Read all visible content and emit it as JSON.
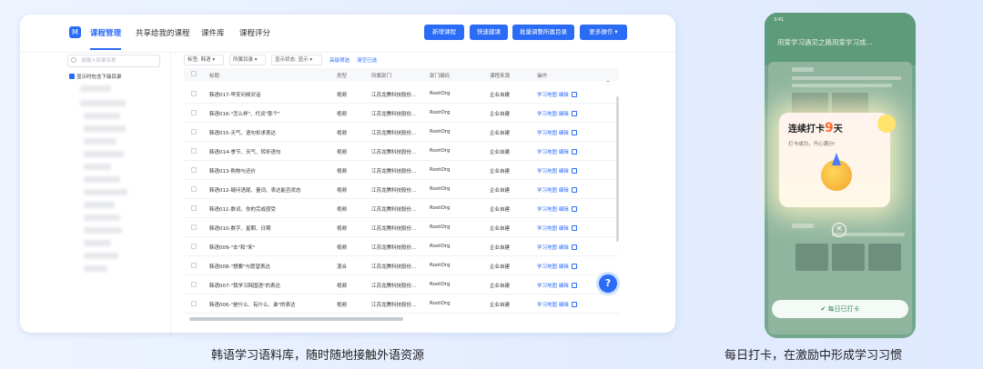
{
  "nav": {
    "logo_text": "M",
    "tabs": [
      {
        "label": "课程管理"
      },
      {
        "label": "共享给我的课程"
      },
      {
        "label": "课件库"
      },
      {
        "label": "课程评分"
      }
    ],
    "buttons": {
      "new_course": "新增课程",
      "quick_create": "快速建课",
      "batch_adjust": "批量调整所属目录",
      "more": "更多操作"
    }
  },
  "sidebar": {
    "search_placeholder": "请输入目录名称",
    "include_sub": "显示时包含下级目录"
  },
  "filters": {
    "label1": "标签:",
    "val1": "韩语",
    "val2": "所属目录",
    "val3": "显示状态: 显示",
    "link1": "高级筛选",
    "link2": "清空已选"
  },
  "table": {
    "headers": {
      "title": "标题",
      "type": "类型",
      "dept": "所属部门",
      "code": "部门编码",
      "source": "课程来源",
      "op": "操作"
    },
    "rows": [
      {
        "title": "韩语017-早安问候对话",
        "type": "视频",
        "dept": "江苏龙腾科技股份...",
        "code": "RootOrg",
        "source": "企业自建"
      },
      {
        "title": "韩语016-\"怎么样\"、代词\"那个\"",
        "type": "视频",
        "dept": "江苏龙腾科技股份...",
        "code": "RootOrg",
        "source": "企业自建"
      },
      {
        "title": "韩语015-天气、语句祈求表达",
        "type": "视频",
        "dept": "江苏龙腾科技股份...",
        "code": "RootOrg",
        "source": "企业自建"
      },
      {
        "title": "韩语014-季节、天气、转折语句",
        "type": "视频",
        "dept": "江苏龙腾科技股份...",
        "code": "RootOrg",
        "source": "企业自建"
      },
      {
        "title": "韩语013-购物与还价",
        "type": "视频",
        "dept": "江苏龙腾科技股份...",
        "code": "RootOrg",
        "source": "企业自建"
      },
      {
        "title": "韩语012-疑问语尾、量词、表达能否状态",
        "type": "视频",
        "dept": "江苏龙腾科技股份...",
        "code": "RootOrg",
        "source": "企业自建"
      },
      {
        "title": "韩语011-数词、你的完成感受",
        "type": "视频",
        "dept": "江苏龙腾科技股份...",
        "code": "RootOrg",
        "source": "企业自建"
      },
      {
        "title": "韩语010-数字、星期、日期",
        "type": "视频",
        "dept": "江苏龙腾科技股份...",
        "code": "RootOrg",
        "source": "企业自建"
      },
      {
        "title": "韩语009-\"去\"和\"来\"",
        "type": "视频",
        "dept": "江苏龙腾科技股份...",
        "code": "RootOrg",
        "source": "企业自建"
      },
      {
        "title": "韩语008-\"想要\"与愿望表达",
        "type": "混合",
        "dept": "江苏龙腾科技股份...",
        "code": "RootOrg",
        "source": "企业自建"
      },
      {
        "title": "韩语007-\"我学习韩国语\"的表达",
        "type": "视频",
        "dept": "江苏龙腾科技股份...",
        "code": "RootOrg",
        "source": "企业自建"
      },
      {
        "title": "韩语006-\"是什么、有什么、谁\"的表达",
        "type": "视频",
        "dept": "江苏龙腾科技股份...",
        "code": "RootOrg",
        "source": "企业自建"
      }
    ],
    "op_study": "学习地图",
    "op_edit": "编辑"
  },
  "help_label": "?",
  "captions": {
    "left": "韩语学习语料库，随时随地接触外语资源",
    "right": "每日打卡，在激励中形成学习习惯"
  },
  "phone": {
    "status_time": "3:41",
    "title": "用爱学习遇见之路用爱学习成...",
    "popup_title_pre": "连续打卡",
    "popup_num": "9",
    "popup_title_post": "天",
    "popup_sub": "打卡成功，开心满分!",
    "close": "×",
    "punch_btn": "✔ 每日已打卡"
  }
}
